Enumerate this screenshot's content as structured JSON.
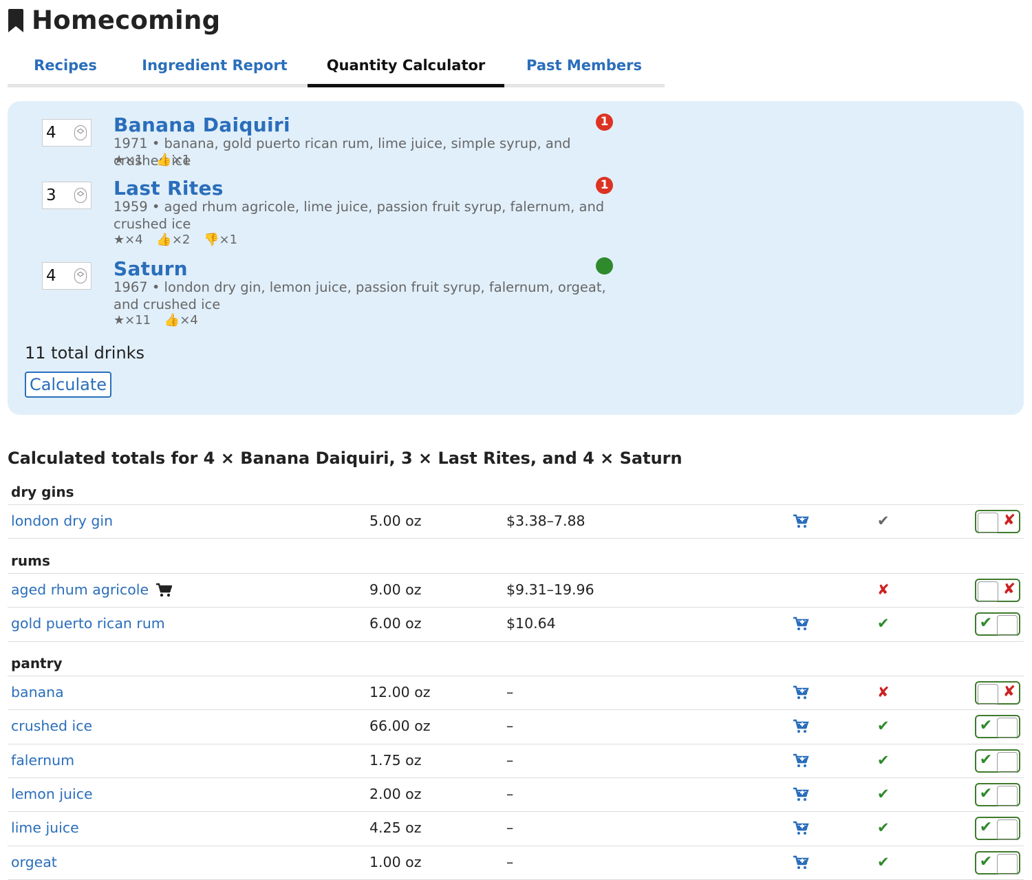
{
  "app": {
    "title": "Homecoming"
  },
  "tabs": [
    {
      "label": "Recipes"
    },
    {
      "label": "Ingredient Report"
    },
    {
      "label": "Quantity Calculator"
    },
    {
      "label": "Past Members"
    }
  ],
  "recipes": [
    {
      "qty": "4",
      "name": "Banana Daiquiri",
      "desc": "1971 • banana, gold puerto rican rum, lime juice, simple syrup, and crushed ice",
      "stats": [
        "★×1",
        "👍×1"
      ],
      "badge": "1",
      "badge_color": "#dd3322"
    },
    {
      "qty": "3",
      "name": "Last Rites",
      "desc": "1959 • aged rhum agricole, lime juice, passion fruit syrup, falernum, and crushed ice",
      "stats": [
        "★×4",
        "👍×2",
        "👎×1"
      ],
      "badge": "1",
      "badge_color": "#dd3322"
    },
    {
      "qty": "4",
      "name": "Saturn",
      "desc": "1967 • london dry gin, lemon juice, passion fruit syrup, falernum, orgeat, and crushed ice",
      "stats": [
        "★×11",
        "👍×4"
      ],
      "badge": "",
      "badge_color": "#2e8a2a"
    }
  ],
  "total_text": "11 total drinks",
  "calculate_label": "Calculate",
  "results_title": "Calculated totals for 4 × Banana Daiquiri, 3 × Last Rites, and 4 × Saturn",
  "groups": [
    {
      "label": "dry gins",
      "items": [
        {
          "name": "london dry gin",
          "amount": "5.00 oz",
          "price": "$3.38–7.88",
          "cart": true,
          "inline_cart": false,
          "status": "✔",
          "status_color": "#666666",
          "toggle": "off"
        }
      ]
    },
    {
      "label": "rums",
      "items": [
        {
          "name": "aged rhum agricole",
          "amount": "9.00 oz",
          "price": "$9.31–19.96",
          "cart": false,
          "inline_cart": true,
          "status": "✘",
          "status_color": "#cc2222",
          "toggle": "off"
        },
        {
          "name": "gold puerto rican rum",
          "amount": "6.00 oz",
          "price": "$10.64",
          "cart": true,
          "inline_cart": false,
          "status": "✔",
          "status_color": "#2e8a2a",
          "toggle": "on"
        }
      ]
    },
    {
      "label": "pantry",
      "items": [
        {
          "name": "banana",
          "amount": "12.00 oz",
          "price": "–",
          "cart": true,
          "inline_cart": false,
          "status": "✘",
          "status_color": "#cc2222",
          "toggle": "off"
        },
        {
          "name": "crushed ice",
          "amount": "66.00 oz",
          "price": "–",
          "cart": true,
          "inline_cart": false,
          "status": "✔",
          "status_color": "#2e8a2a",
          "toggle": "on"
        },
        {
          "name": "falernum",
          "amount": "1.75 oz",
          "price": "–",
          "cart": true,
          "inline_cart": false,
          "status": "✔",
          "status_color": "#2e8a2a",
          "toggle": "on"
        },
        {
          "name": "lemon juice",
          "amount": "2.00 oz",
          "price": "–",
          "cart": true,
          "inline_cart": false,
          "status": "✔",
          "status_color": "#2e8a2a",
          "toggle": "on"
        },
        {
          "name": "lime juice",
          "amount": "4.25 oz",
          "price": "–",
          "cart": true,
          "inline_cart": false,
          "status": "✔",
          "status_color": "#2e8a2a",
          "toggle": "on"
        },
        {
          "name": "orgeat",
          "amount": "1.00 oz",
          "price": "–",
          "cart": true,
          "inline_cart": false,
          "status": "✔",
          "status_color": "#2e8a2a",
          "toggle": "on"
        }
      ]
    }
  ],
  "colors": {
    "link": "#2a6ebb",
    "panel": "#e1effa",
    "ok": "#2e8a2a",
    "bad": "#cc2222"
  }
}
